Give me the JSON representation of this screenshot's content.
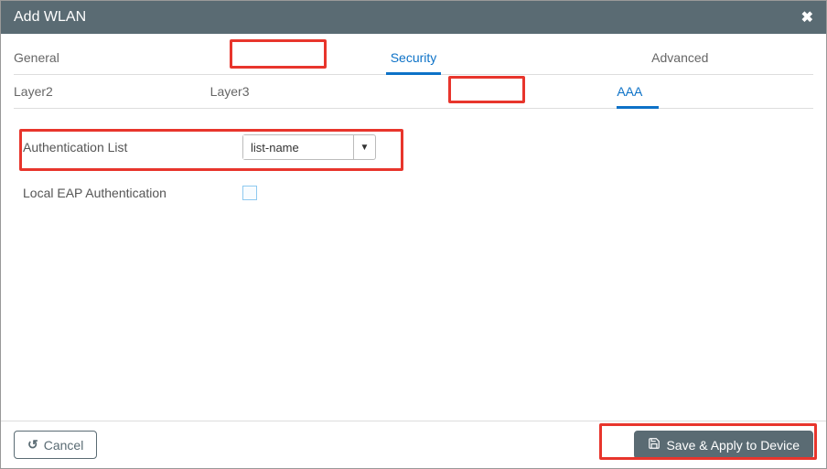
{
  "header": {
    "title": "Add WLAN"
  },
  "tabs": {
    "general": "General",
    "security": "Security",
    "advanced": "Advanced"
  },
  "subtabs": {
    "layer2": "Layer2",
    "layer3": "Layer3",
    "aaa": "AAA"
  },
  "form": {
    "auth_list_label": "Authentication List",
    "auth_list_value": "list-name",
    "local_eap_label": "Local EAP Authentication"
  },
  "footer": {
    "cancel": "Cancel",
    "save": "Save & Apply to Device"
  }
}
